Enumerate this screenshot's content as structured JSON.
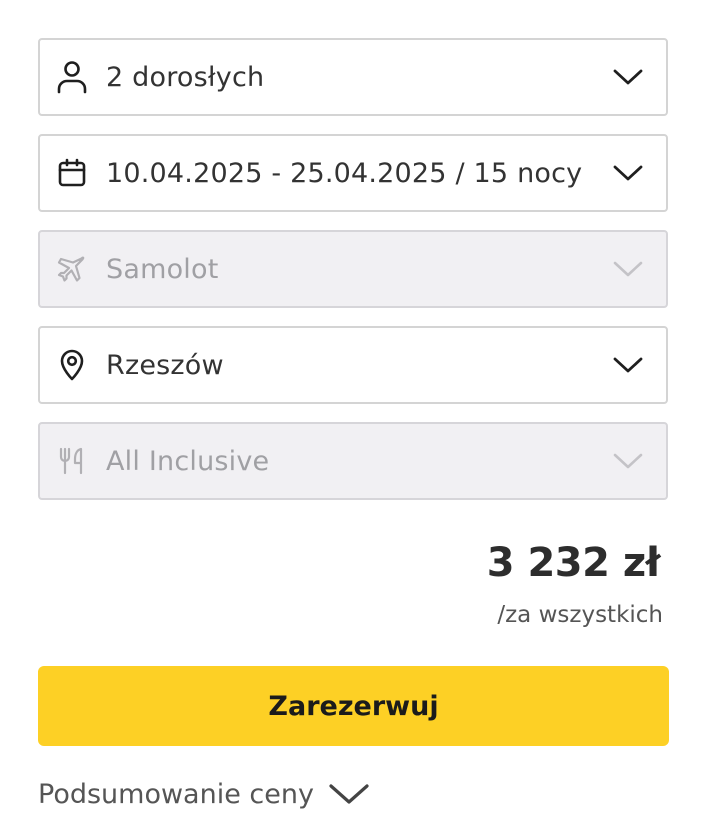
{
  "form": {
    "travelers": {
      "value": "2 dorosłych",
      "icon": "person-icon",
      "disabled": false
    },
    "dates": {
      "value": "10.04.2025 - 25.04.2025 / 15 nocy",
      "icon": "calendar-icon",
      "disabled": false
    },
    "transport": {
      "value": "Samolot",
      "icon": "plane-icon",
      "disabled": true
    },
    "departure": {
      "value": "Rzeszów",
      "icon": "location-pin-icon",
      "disabled": false
    },
    "board": {
      "value": "All Inclusive",
      "icon": "cutlery-icon",
      "disabled": true
    }
  },
  "price": {
    "amount": "3 232 zł",
    "note": "/za wszystkich"
  },
  "book_button": {
    "label": "Zarezerwuj",
    "color": "#fdd025"
  },
  "summary": {
    "label": "Podsumowanie ceny",
    "icon": "chevron-down-icon"
  }
}
